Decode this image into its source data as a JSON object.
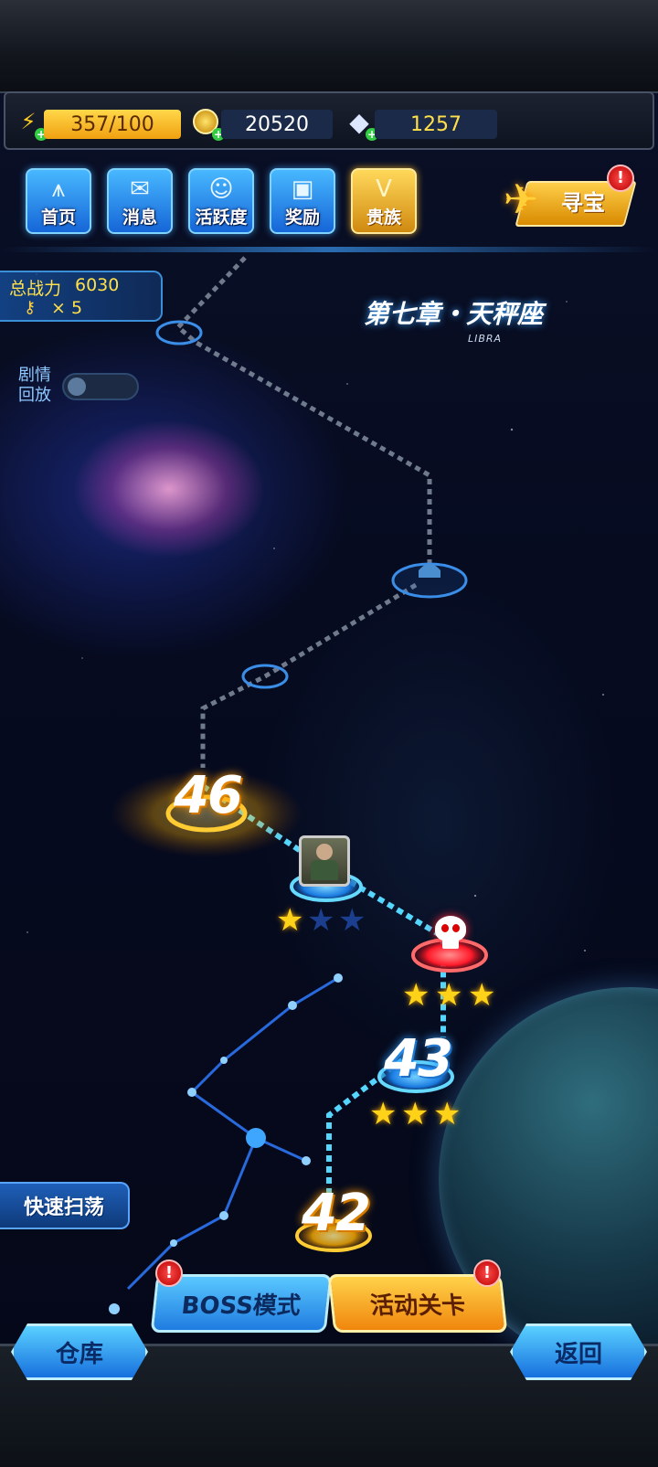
{
  "resources": {
    "energy": "357/100",
    "gold": "20520",
    "diamonds": "1257"
  },
  "menu": [
    {
      "label": "首页",
      "icon": "home-icon"
    },
    {
      "label": "消息",
      "icon": "message-icon"
    },
    {
      "label": "活跃度",
      "icon": "smiley-icon"
    },
    {
      "label": "奖励",
      "icon": "gift-icon"
    },
    {
      "label": "贵族",
      "icon": "vip-icon"
    }
  ],
  "treasure": {
    "label": "寻宝",
    "badge": "!"
  },
  "power": {
    "label": "总战力",
    "value": "6030",
    "keys": "× 5"
  },
  "replay": {
    "label": "剧情回放"
  },
  "chapter": {
    "title": "第七章・天秤座",
    "subtitle": "LIBRA"
  },
  "levels": [
    {
      "number": "46",
      "stars": ""
    },
    {
      "number": "",
      "stars": 1
    },
    {
      "number": "",
      "stars": 3
    },
    {
      "number": "43",
      "stars": 3
    },
    {
      "number": "42",
      "stars": ""
    }
  ],
  "bottom": {
    "quick_sweep": "快速扫荡",
    "boss_mode": "BOSS模式",
    "event_stage": "活动关卡",
    "warehouse": "仓库",
    "back": "返回",
    "badge": "!"
  },
  "colors": {
    "accent_blue": "#1f7ce0",
    "accent_gold": "#ffd21a",
    "boss_red": "#ff2a3a"
  }
}
